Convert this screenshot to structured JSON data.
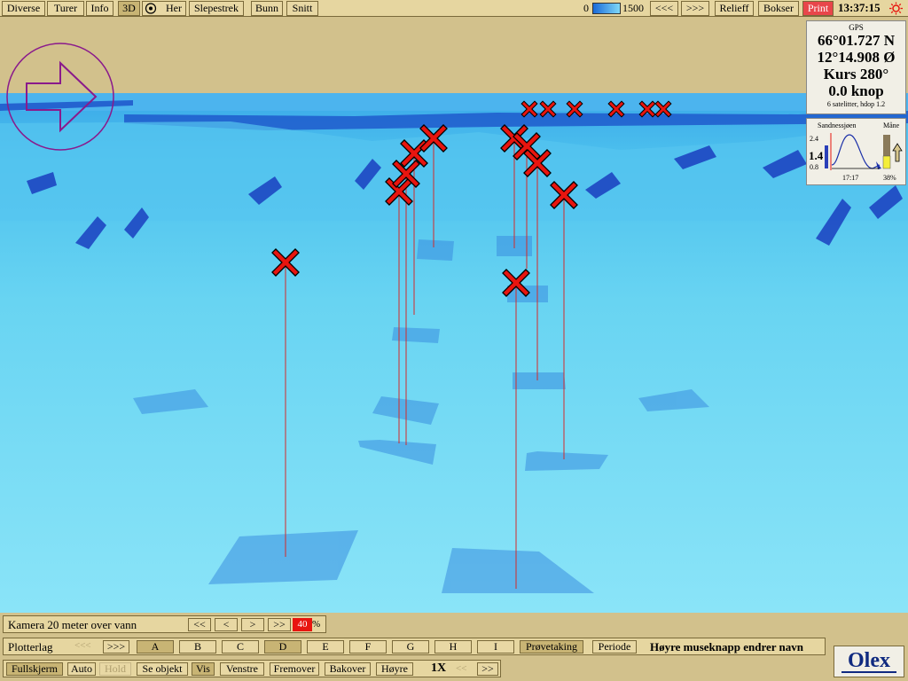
{
  "toolbar": {
    "diverse": "Diverse",
    "turer": "Turer",
    "info": "Info",
    "mode_3d": "3D",
    "her": "Her",
    "slepestrek": "Slepestrek",
    "bunn": "Bunn",
    "snitt": "Snitt",
    "depth_min": "0",
    "depth_max": "1500",
    "prev": "<<<",
    "next": ">>>",
    "relieff": "Relieff",
    "bokser": "Bokser",
    "print": "Print",
    "time": "13:37:15"
  },
  "gps": {
    "title": "GPS",
    "lat": "66°01.727 N",
    "lon": "12°14.908 Ø",
    "course": "Kurs 280°",
    "speed": "0.0 knop",
    "satellites": "6 satelitter, hdop 1.2"
  },
  "tide": {
    "location": "Sandnessjøen",
    "moon_label": "Måne",
    "high": "2.4",
    "current": "1.4",
    "low": "0.8",
    "time": "17:17",
    "moon_pct": "38%"
  },
  "camera_bar": {
    "label": "Kamera 20 meter over vann",
    "btn_fast_back": "<<",
    "btn_back": "<",
    "btn_fwd": ">",
    "btn_fast_fwd": ">>",
    "percent_value": "40",
    "percent_sign": "%"
  },
  "plotter_bar": {
    "label": "Plotterlag",
    "prev": "<<<",
    "next": ">>>",
    "layers": [
      "A",
      "B",
      "C",
      "D",
      "E",
      "F",
      "G",
      "H",
      "I"
    ],
    "provetaking": "Prøvetaking",
    "periode": "Periode",
    "hint": "Høyre museknapp endrer navn"
  },
  "nav_bar": {
    "fullskjerm": "Fullskjerm",
    "auto": "Auto",
    "hold": "Hold",
    "se_objekt": "Se objekt",
    "vis": "Vis",
    "venstre": "Venstre",
    "fremover": "Fremover",
    "bakover": "Bakover",
    "hoyre": "Høyre",
    "speed": "1X",
    "slower": "<<",
    "faster": ">>"
  },
  "brand": "Olex",
  "colors": {
    "panel": "#e6d6a0",
    "sky": "#d2c18c",
    "sea_light": "#7fe0f4",
    "sea_dark": "#1a4fc8",
    "marker": "#e8150f"
  },
  "icons": {
    "her": "target-icon",
    "sun": "sun-icon",
    "heading": "heading-arrow-icon",
    "markers": "x-marker-icon"
  }
}
